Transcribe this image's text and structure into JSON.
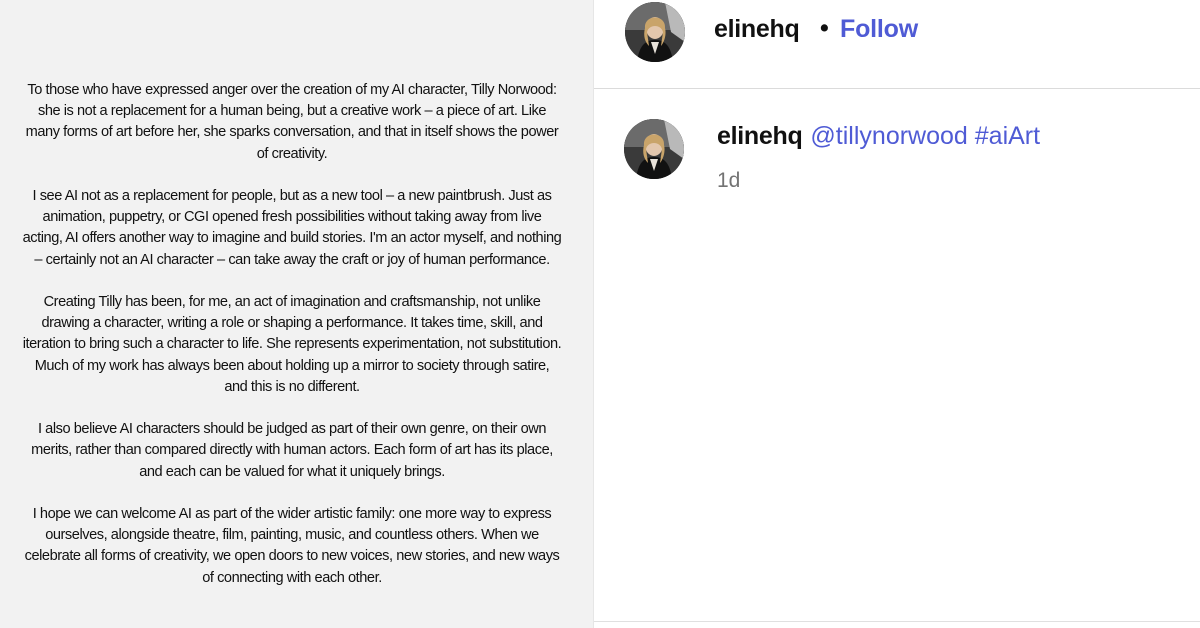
{
  "statement": {
    "paragraphs": [
      "To those who have expressed anger over the creation of my AI character, Tilly Norwood: she is not a replacement for a human being, but a creative work – a piece of art. Like many forms of art before her, she sparks conversation, and that in itself shows the power of creativity.",
      "I see AI not as a replacement for people, but as a new tool – a new paintbrush. Just as animation, puppetry, or CGI opened fresh possibilities without taking away from live acting, AI offers another way to imagine and build stories. I'm an actor myself, and nothing – certainly not an AI character – can take away the craft or joy of human performance.",
      "Creating Tilly has been, for me, an act of imagination and craftsmanship, not unlike drawing a character, writing a role or shaping a performance. It takes time, skill, and iteration to bring such a character to life. She represents experimentation, not substitution. Much of my work has always been about holding up a mirror to society through satire, and this is no different.",
      "I also believe AI characters should be judged as part of their own genre, on their own merits, rather than compared directly with human actors. Each form of art has its place, and each can be valued for what it uniquely brings.",
      "I hope we can welcome AI as part of the wider artistic family: one more way to express ourselves, alongside theatre, film, painting, music, and countless others. When we celebrate all forms of creativity, we open doors to new voices, new stories, and new ways of connecting with each other."
    ]
  },
  "header": {
    "username": "elinehq",
    "separator": "•",
    "follow_label": "Follow"
  },
  "caption": {
    "username": "elinehq",
    "mention": "@tillynorwood",
    "hashtag": "#aiArt",
    "timestamp": "1d"
  },
  "colors": {
    "link": "#4f5bd5",
    "text": "#111111",
    "muted": "#737373",
    "image_bg": "#f2f2f2"
  }
}
